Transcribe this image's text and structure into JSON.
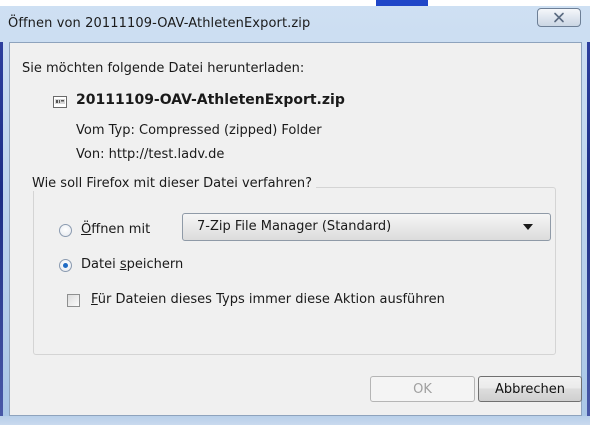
{
  "window": {
    "title": "Öffnen von 20111109-OAV-AthletenExport.zip",
    "close_symbol": "✕"
  },
  "dialog": {
    "lead": "Sie möchten folgende Datei herunterladen:",
    "file_icon": "zip-file-icon",
    "filename": "20111109-OAV-AthletenExport.zip",
    "type_label": "Vom Typ:",
    "type_value": "Compressed (zipped) Folder",
    "from_label": "Von:",
    "from_value": "http://test.ladv.de"
  },
  "action_group": {
    "legend": "Wie soll Firefox mit dieser Datei verfahren?",
    "open_with": {
      "accesskey": "Ö",
      "label_rest": "ffnen mit",
      "selected": false
    },
    "application_select": {
      "value": "7-Zip File Manager (Standard)"
    },
    "save_file": {
      "label_before": "Datei ",
      "accesskey": "s",
      "label_after": "peichern",
      "selected": true
    },
    "always_checkbox": {
      "accesskey": "F",
      "label_rest": "ür Dateien dieses Typs immer diese Aktion ausführen",
      "checked": false
    }
  },
  "buttons": {
    "ok": "OK",
    "cancel": "Abbrechen"
  },
  "colors": {
    "accent": "#1f6bc4",
    "dialog_bg": "#f0f0f0",
    "frame": "#b9d1ec"
  }
}
